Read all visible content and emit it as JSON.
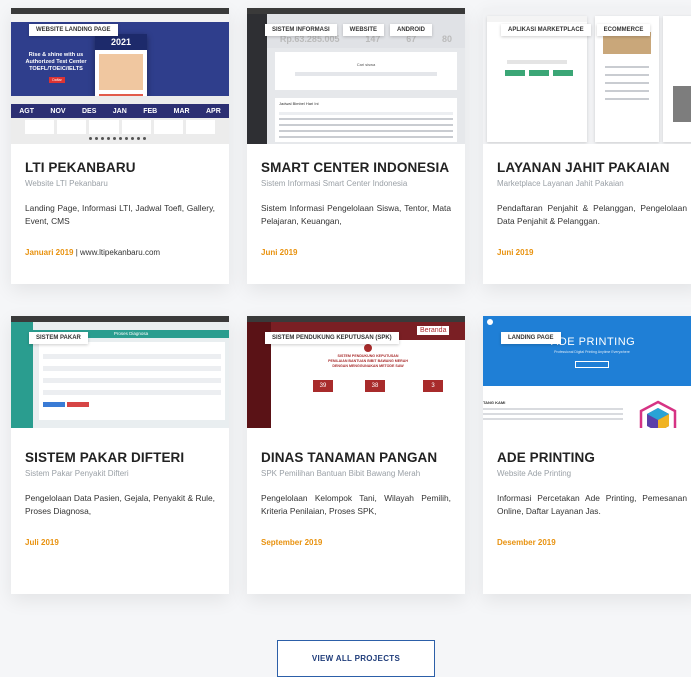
{
  "projects": [
    {
      "tags": [
        "Website Landing Page"
      ],
      "title": "LTI PEKANBARU",
      "subtitle": "Website LTI Pekanbaru",
      "description": "Landing Page, Informasi LTI, Jadwal Toefl, Gallery, Event, CMS",
      "date": "Januari 2019",
      "extra": "www.ltipekanbaru.com",
      "thumb": {
        "headline": "Rise & shine with us\nAuthorized Test Center\nTOEFL/TOEIC/IELTS",
        "button": "Daftar",
        "badge_year": "2021",
        "months": [
          "AGT",
          "NOV",
          "DES",
          "JAN",
          "FEB",
          "MAR",
          "APR"
        ]
      }
    },
    {
      "tags": [
        "Sistem Informasi",
        "Website",
        "Android"
      ],
      "title": "SMART CENTER INDONESIA",
      "subtitle": "Sistem Informasi Smart Center Indonesia",
      "description": "Sistem Informasi Pengelolaan Siswa, Tentor, Mata Pelajaran, Keuangan,",
      "date": "Juni 2019",
      "thumb": {
        "stats": [
          "Rp.63.285.005",
          "147",
          "67",
          "80"
        ],
        "panel_title": "Cari siswa",
        "table_title": "Jadwal Bimbel Hari Ini"
      }
    },
    {
      "tags": [
        "Aplikasi Marketplace",
        "Ecommerce"
      ],
      "title": "LAYANAN JAHIT PAKAIAN",
      "subtitle": "Marketplace Layanan Jahit Pakaian",
      "description": "Pendaftaran Penjahit & Pelanggan, Pengelolaan Data Penjahit & Pelanggan.",
      "date": "Juni 2019",
      "thumb": {}
    },
    {
      "tags": [
        "Sistem Pakar"
      ],
      "title": "SISTEM PAKAR DIFTERI",
      "subtitle": "Sistem Pakar Penyakit Difteri",
      "description": "Pengelolaan Data Pasien, Gejala, Penyakit & Rule, Proses Diagnosa,",
      "date": "Juli 2019",
      "thumb": {
        "header": "Proses Diagnosa"
      }
    },
    {
      "tags": [
        "Sistem Pendukung Keputusan (SPK)"
      ],
      "title": "DINAS TANAMAN PANGAN",
      "subtitle": "SPK Pemilihan Bantuan Bibit Bawang Merah",
      "description": "Pengelolaan Kelompok Tani, Wilayah Pemilih, Kriteria Penilaian, Proses SPK,",
      "date": "September 2019",
      "thumb": {
        "corner": "Beranda",
        "heading": "SISTEM PENDUKUNG KEPUTUSAN\nPENILAIAN BANTUAN BIBIT BAWANG MERAH\nDENGAN MENGGUNAKAN METODE SAW",
        "counts": [
          "39",
          "38",
          "3"
        ]
      }
    },
    {
      "tags": [
        "Landing Page"
      ],
      "title": "ADE PRINTING",
      "subtitle": "Website Ade Printing",
      "description": "Informasi Percetakan Ade Printing, Pemesanan Online, Daftar Layanan Jas.",
      "date": "Desember 2019",
      "thumb": {
        "brand": "ADE PRINTING",
        "tagline": "Professional Digital Printing Anytime Everywhere",
        "section": "TANG KAMI"
      }
    }
  ],
  "cta": {
    "label": "View All Projects"
  },
  "colors": {
    "accent_date": "#e8920f",
    "cta_border": "#2c5fa8"
  }
}
